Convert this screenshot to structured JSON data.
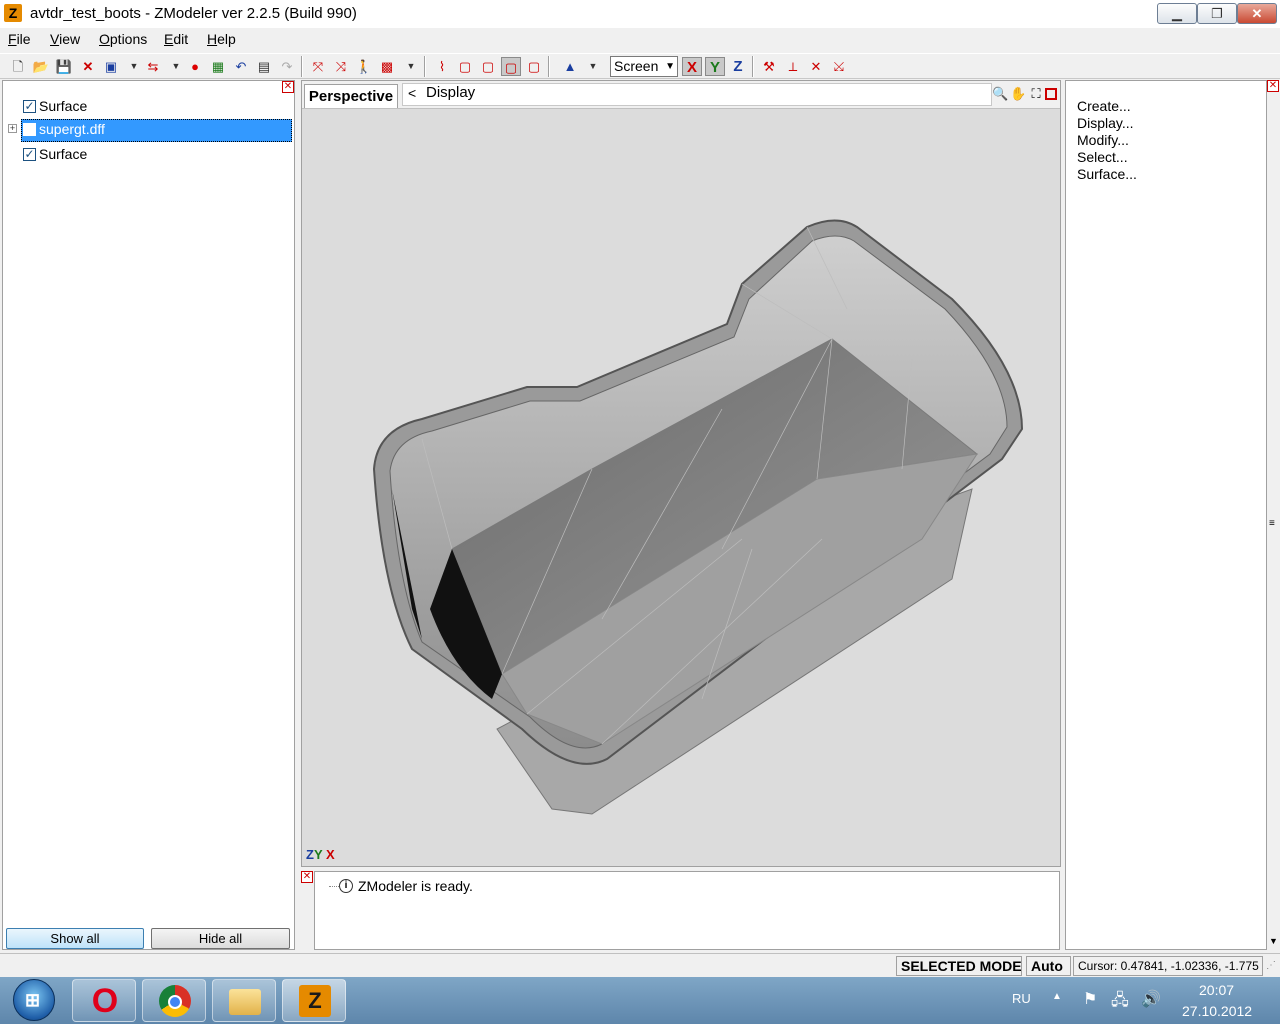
{
  "window": {
    "app_icon": "Z",
    "title": "avtdr_test_boots - ZModeler ver 2.2.5 (Build 990)",
    "controls": {
      "minimize": "▁",
      "maximize": "❐",
      "close": "✕"
    }
  },
  "menu": [
    "File",
    "View",
    "Options",
    "Edit",
    "Help"
  ],
  "toolbar": {
    "coord_mode": "Screen",
    "axes": [
      "X",
      "Y",
      "Z"
    ],
    "icons": [
      "new-file-icon",
      "open-folder-icon",
      "save-icon",
      "delete-icon",
      "import-icon",
      "export-icon",
      "record-icon",
      "image-icon",
      "undo-icon",
      "properties-icon",
      "redo-icon",
      "select-icon",
      "move-icon",
      "walk-icon",
      "render-icon",
      "edge-icon",
      "box-icon",
      "box2-icon",
      "box3-icon",
      "box4-icon",
      "fill-icon",
      "tool1-icon",
      "tool2-icon",
      "tool3-icon",
      "tool4-icon"
    ]
  },
  "tree": {
    "items": [
      {
        "label": "Surface",
        "checked": true,
        "selected": false,
        "expandable": false
      },
      {
        "label": "supergt.dff",
        "checked": false,
        "selected": true,
        "expandable": true
      },
      {
        "label": "Surface",
        "checked": true,
        "selected": false,
        "expandable": false
      }
    ],
    "show_all": "Show all",
    "hide_all": "Hide all"
  },
  "viewport": {
    "tab": "Perspective",
    "back": "<",
    "crumb": "Display",
    "axis_indicator": {
      "z": "Z",
      "y": "Y",
      "x": "X"
    }
  },
  "log": {
    "message": "ZModeler is ready."
  },
  "commands": [
    "Create...",
    "Display...",
    "Modify...",
    "Select...",
    "Surface..."
  ],
  "status": {
    "mode": "SELECTED MODE",
    "auto": "Auto",
    "cursor": "Cursor: 0.47841, -1.02336, -1.775"
  },
  "taskbar": {
    "apps": [
      "Opera",
      "Chrome",
      "Explorer",
      "ZModeler"
    ],
    "lang": "RU",
    "time": "20:07",
    "date": "27.10.2012"
  }
}
